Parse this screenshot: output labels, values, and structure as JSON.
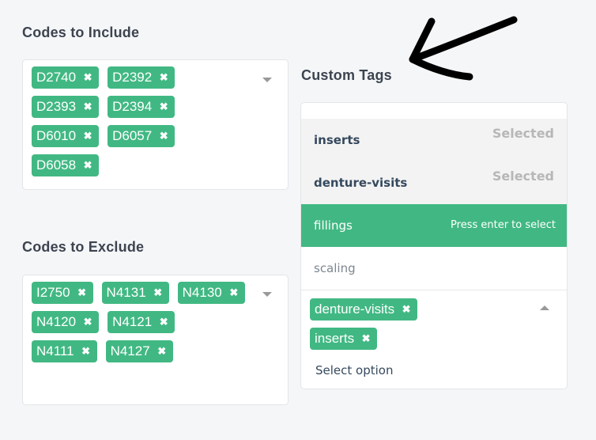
{
  "include": {
    "title": "Codes to Include",
    "tags": [
      {
        "label": "D2740"
      },
      {
        "label": "D2392"
      },
      {
        "label": "D2393"
      },
      {
        "label": "D2394"
      },
      {
        "label": "D6010"
      },
      {
        "label": "D6057"
      },
      {
        "label": "D6058"
      }
    ]
  },
  "exclude": {
    "title": "Codes to Exclude",
    "tags": [
      {
        "label": "I2750"
      },
      {
        "label": "N4131"
      },
      {
        "label": "N4130"
      },
      {
        "label": "N4120"
      },
      {
        "label": "N4121"
      },
      {
        "label": "N4111"
      },
      {
        "label": "N4127"
      }
    ]
  },
  "custom_tags": {
    "title": "Custom Tags",
    "options": [
      {
        "label": "inserts",
        "state": "selected",
        "hint": "Selected"
      },
      {
        "label": "denture-visits",
        "state": "selected",
        "hint": "Selected"
      },
      {
        "label": "fillings",
        "state": "highlighted",
        "hint": "Press enter to select"
      },
      {
        "label": "scaling",
        "state": "plain",
        "hint": ""
      }
    ],
    "selected_tags": [
      {
        "label": "denture-visits"
      },
      {
        "label": "inserts"
      }
    ],
    "placeholder": "Select option"
  },
  "remove_icon": "times-icon",
  "colors": {
    "accent": "#41b883",
    "background": "#f5f6f8",
    "selected_option_bg": "#f3f3f3",
    "hint_gray": "#b7b7b7",
    "arrow": "#000000"
  }
}
